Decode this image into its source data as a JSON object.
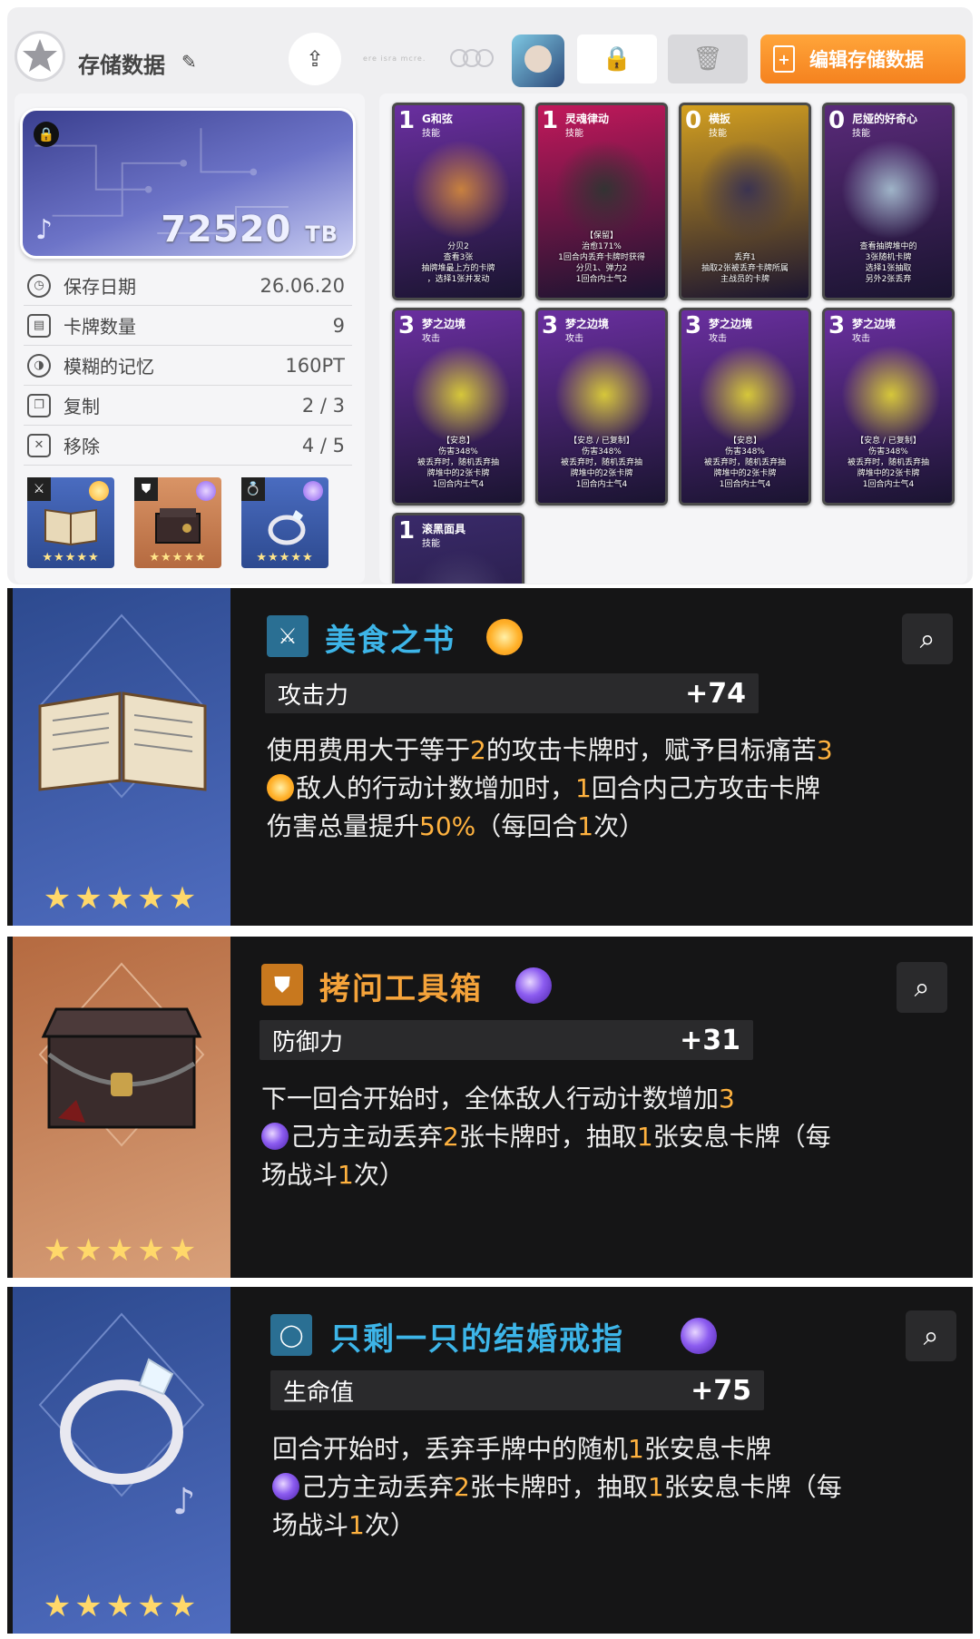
{
  "header": {
    "title": "存储数据",
    "faint_text": "ere isra mcre.",
    "edit_label": "编辑存储数据"
  },
  "storage": {
    "tb_value": "72520",
    "tb_unit": "TB"
  },
  "info": [
    {
      "label": "保存日期",
      "value": "26.06.20"
    },
    {
      "label": "卡牌数量",
      "value": "9"
    },
    {
      "label": "模糊的记忆",
      "value": "160PT"
    },
    {
      "label": "复制",
      "value": "2 / 3"
    },
    {
      "label": "移除",
      "value": "4 / 5"
    }
  ],
  "equips": [
    {
      "stars": "★★★★★",
      "rarity_color": "#ffb12a"
    },
    {
      "stars": "★★★★★",
      "rarity_color": "#8c5cf0"
    },
    {
      "stars": "★★★★★",
      "rarity_color": "#8c5cf0"
    }
  ],
  "cards": [
    {
      "cost": "1",
      "name": "G和弦",
      "type": "技能",
      "desc": "分贝2\n查看3张\n抽牌堆最上方的卡牌\n，选择1张并发动",
      "bg": "#6a2fa0",
      "art": "#c8813f"
    },
    {
      "cost": "1",
      "name": "灵魂律动",
      "type": "技能",
      "desc": "【保留】\n治愈171%\n1回合内丢弃卡牌时获得\n分贝1、弹力2\n1回合内士气2",
      "bg": "#c2185b",
      "art": "#333"
    },
    {
      "cost": "0",
      "name": "横扳",
      "type": "技能",
      "desc": "丢弃1\n抽取2张被丢弃卡牌所属\n主战员的卡牌",
      "bg": "#d4a020",
      "art": "#3b3350"
    },
    {
      "cost": "0",
      "name": "尼娅的好奇心",
      "type": "技能",
      "desc": "查看抽牌堆中的\n3张随机卡牌\n选择1张抽取\n另外2张丢弃",
      "bg": "#5a2a7a",
      "art": "#9fb4c8"
    },
    {
      "cost": "3",
      "name": "梦之边境",
      "type": "攻击",
      "desc": "【安息】\n伤害348%\n被丢弃时，随机丢弃抽\n牌堆中的2张卡牌\n1回合内士气4",
      "bg": "#6a2fa0",
      "art": "#d6c73a"
    },
    {
      "cost": "3",
      "name": "梦之边境",
      "type": "攻击",
      "desc": "【安息 / 已复制】\n伤害348%\n被丢弃时，随机丢弃抽\n牌堆中的2张卡牌\n1回合内士气4",
      "bg": "#6a2fa0",
      "art": "#d6c73a"
    },
    {
      "cost": "3",
      "name": "梦之边境",
      "type": "攻击",
      "desc": "【安息】\n伤害348%\n被丢弃时，随机丢弃抽\n牌堆中的2张卡牌\n1回合内士气4",
      "bg": "#6a2fa0",
      "art": "#d6c73a"
    },
    {
      "cost": "3",
      "name": "梦之边境",
      "type": "攻击",
      "desc": "【安息 / 已复制】\n伤害348%\n被丢弃时，随机丢弃抽\n牌堆中的2张卡牌\n1回合内士气4",
      "bg": "#6a2fa0",
      "art": "#d6c73a"
    },
    {
      "cost": "1",
      "name": "滚黑面具",
      "type": "技能",
      "desc": "",
      "bg": "#3a2a6a",
      "art": "#4a4070"
    }
  ],
  "details": [
    {
      "name": "美食之书",
      "name_color": "#3db5e8",
      "stat_label": "攻击力",
      "stat_value": "+74",
      "line1a": "使用费用大于等于",
      "line1b": "2",
      "line1c": "的攻击卡牌时，赋予目标痛苦",
      "line1d": "3",
      "line2a": "敌人的行动计数增加时，",
      "line2b": "1",
      "line2c": "回合内己方攻击卡牌",
      "line3a": "伤害总量提升",
      "line3b": "50%",
      "line3c": "（每回合",
      "line3d": "1",
      "line3e": "次）",
      "stars": "★★★★★",
      "bg": "#3d5da3"
    },
    {
      "name": "拷问工具箱",
      "name_color": "#f5a33a",
      "stat_label": "防御力",
      "stat_value": "+31",
      "line1a": "下一回合开始时，全体敌人行动计数增加",
      "line1b": "3",
      "line2a": "己方主动丢弃",
      "line2b": "2",
      "line2c": "张卡牌时，抽取",
      "line2d": "1",
      "line2e": "张安息卡牌（每",
      "line3a": "场战斗",
      "line3b": "1",
      "line3c": "次）",
      "stars": "★★★★★",
      "bg": "#c8835a"
    },
    {
      "name": "只剩一只的结婚戒指",
      "name_color": "#3db5e8",
      "stat_label": "生命值",
      "stat_value": "+75",
      "line1a": "回合开始时，丢弃手牌中的随机",
      "line1b": "1",
      "line1c": "张安息卡牌",
      "line2a": "己方主动丢弃",
      "line2b": "2",
      "line2c": "张卡牌时，抽取",
      "line2d": "1",
      "line2e": "张安息卡牌（每",
      "line3a": "场战斗",
      "line3b": "1",
      "line3c": "次）",
      "stars": "★★★★★",
      "bg": "#3d5da3"
    }
  ]
}
